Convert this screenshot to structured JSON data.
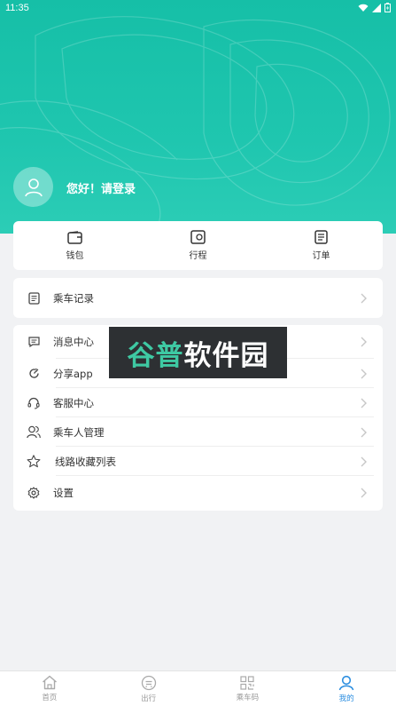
{
  "status_bar": {
    "time": "11:35"
  },
  "profile": {
    "greeting": "您好！请登录"
  },
  "quick_actions": [
    {
      "label": "钱包",
      "icon": "wallet-icon"
    },
    {
      "label": "行程",
      "icon": "itinerary-icon"
    },
    {
      "label": "订单",
      "icon": "order-icon"
    }
  ],
  "records": {
    "label": "乘车记录"
  },
  "menu": [
    {
      "label": "消息中心",
      "icon": "message-icon"
    },
    {
      "label": "分享app",
      "icon": "share-icon"
    },
    {
      "label": "客服中心",
      "icon": "headset-icon"
    },
    {
      "label": "乘车人管理",
      "icon": "users-icon"
    },
    {
      "label": "线路收藏列表",
      "icon": "star-icon"
    },
    {
      "label": "设置",
      "icon": "gear-icon"
    }
  ],
  "watermark": {
    "part1": "谷普",
    "part2": "软件园"
  },
  "tabbar": [
    {
      "label": "首页",
      "icon": "home-icon",
      "active": false
    },
    {
      "label": "出行",
      "icon": "travel-icon",
      "active": false
    },
    {
      "label": "乘车码",
      "icon": "qr-code-icon",
      "active": false
    },
    {
      "label": "我的",
      "icon": "profile-icon",
      "active": true
    }
  ],
  "colors": {
    "brand": "#1fc6af",
    "active_tab": "#2c8ee0",
    "background": "#f1f2f4"
  }
}
